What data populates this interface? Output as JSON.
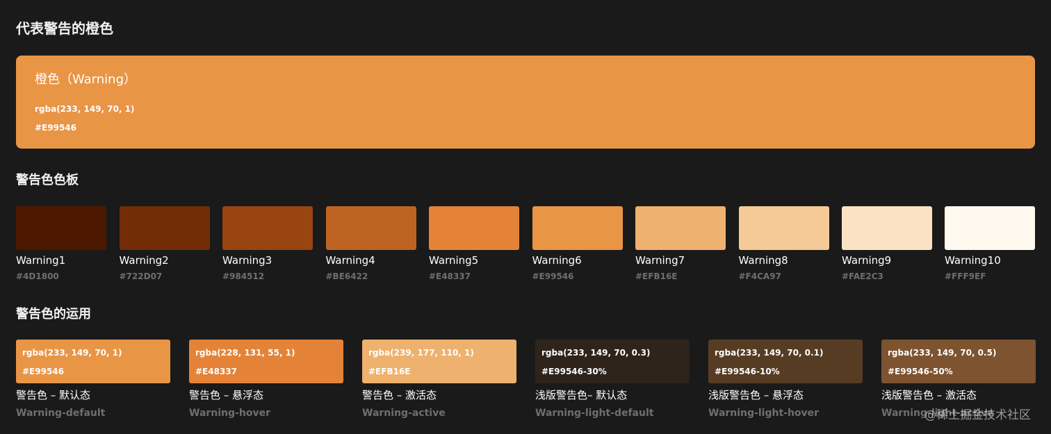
{
  "page": {
    "title": "代表警告的橙色",
    "watermark": "@稀土掘金技术社区"
  },
  "hero": {
    "name": "橙色（Warning）",
    "rgba": "rgba(233, 149, 70, 1)",
    "hex": "#E99546",
    "color": "#E99546"
  },
  "palette": {
    "heading": "警告色色板",
    "items": [
      {
        "name": "Warning1",
        "hex": "#4D1800",
        "color": "#4D1800"
      },
      {
        "name": "Warning2",
        "hex": "#722D07",
        "color": "#722D07"
      },
      {
        "name": "Warning3",
        "hex": "#984512",
        "color": "#984512"
      },
      {
        "name": "Warning4",
        "hex": "#BE6422",
        "color": "#BE6422"
      },
      {
        "name": "Warning5",
        "hex": "#E48337",
        "color": "#E48337"
      },
      {
        "name": "Warning6",
        "hex": "#E99546",
        "color": "#E99546"
      },
      {
        "name": "Warning7",
        "hex": "#EFB16E",
        "color": "#EFB16E"
      },
      {
        "name": "Warning8",
        "hex": "#F4CA97",
        "color": "#F4CA97"
      },
      {
        "name": "Warning9",
        "hex": "#FAE2C3",
        "color": "#FAE2C3"
      },
      {
        "name": "Warning10",
        "hex": "#FFF9EF",
        "color": "#FFF9EF"
      }
    ]
  },
  "usage": {
    "heading": "警告色的运用",
    "items": [
      {
        "rgba": "rgba(233, 149, 70, 1)",
        "hex": "#E99546",
        "label": "警告色 – 默认态",
        "en": "Warning-default",
        "color": "#E99546"
      },
      {
        "rgba": "rgba(228, 131, 55, 1)",
        "hex": "#E48337",
        "label": "警告色 – 悬浮态",
        "en": "Warning-hover",
        "color": "#E48337"
      },
      {
        "rgba": "rgba(239, 177, 110, 1)",
        "hex": "#EFB16E",
        "label": "警告色 – 激活态",
        "en": "Warning-active",
        "color": "#EFB16E"
      },
      {
        "rgba": "rgba(233, 149, 70, 0.3)",
        "hex": "#E99546-30%",
        "label": "浅版警告色– 默认态",
        "en": "Warning-light-default",
        "color": "#2e241b"
      },
      {
        "rgba": "rgba(233, 149, 70, 0.1)",
        "hex": "#E99546-10%",
        "label": "浅版警告色 – 悬浮态",
        "en": "Warning-light-hover",
        "color": "#573c24"
      },
      {
        "rgba": "rgba(233, 149, 70, 0.5)",
        "hex": "#E99546-50%",
        "label": "浅版警告色 – 激活态",
        "en": "Warning-light-active",
        "color": "#7d5330"
      }
    ]
  }
}
